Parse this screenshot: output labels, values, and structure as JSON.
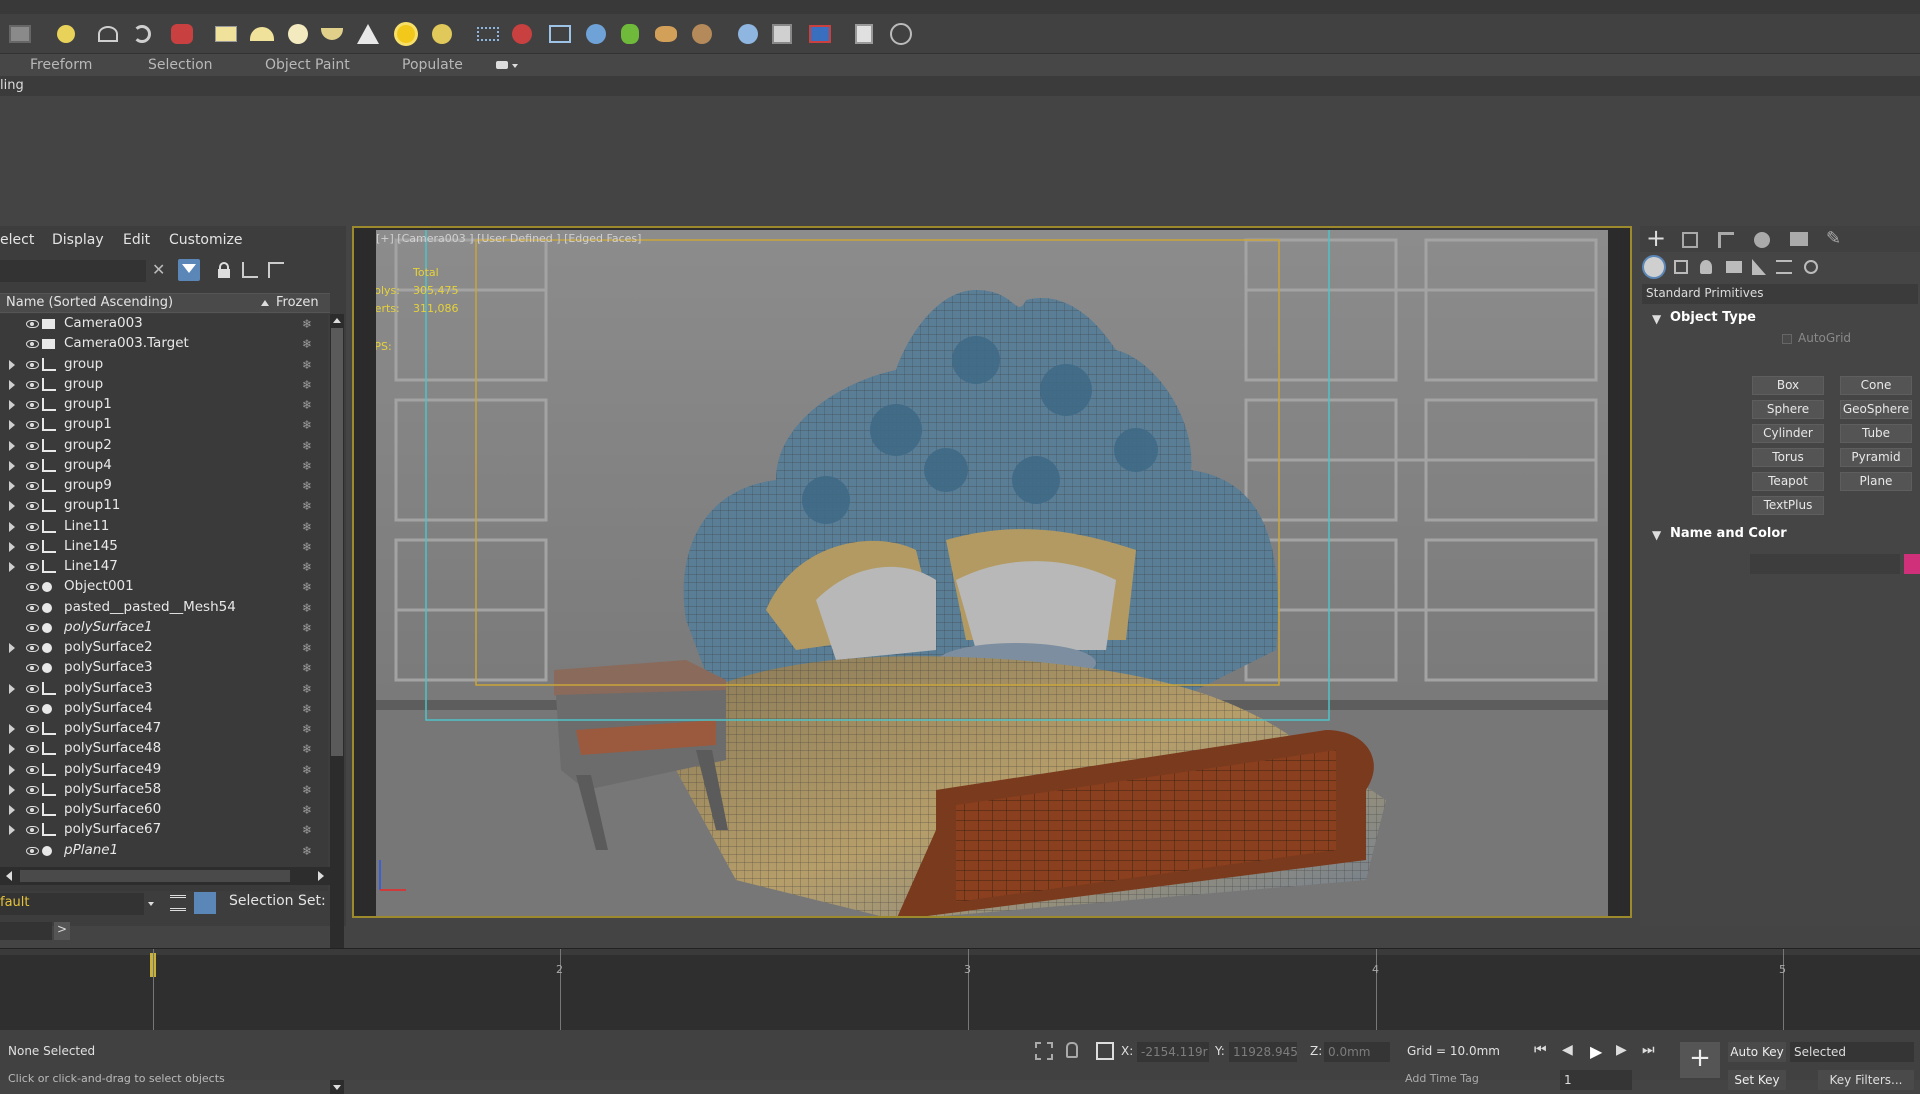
{
  "ribbon": {
    "tabs": [
      "Freeform",
      "Selection",
      "Object Paint",
      "Populate"
    ],
    "strip_label": "ling"
  },
  "scene_explorer": {
    "menu": [
      "elect",
      "Display",
      "Edit",
      "Customize"
    ],
    "column_name": "Name (Sorted Ascending)",
    "column_frozen": "Frozen",
    "items": [
      {
        "name": "Camera003",
        "expand": false,
        "type": "camera",
        "italic": false
      },
      {
        "name": "Camera003.Target",
        "expand": false,
        "type": "camera",
        "italic": false
      },
      {
        "name": "group",
        "expand": true,
        "type": "helper",
        "italic": false
      },
      {
        "name": "group",
        "expand": true,
        "type": "helper",
        "italic": false
      },
      {
        "name": "group1",
        "expand": true,
        "type": "helper",
        "italic": false
      },
      {
        "name": "group1",
        "expand": true,
        "type": "helper",
        "italic": false
      },
      {
        "name": "group2",
        "expand": true,
        "type": "helper",
        "italic": false
      },
      {
        "name": "group4",
        "expand": true,
        "type": "helper",
        "italic": false
      },
      {
        "name": "group9",
        "expand": true,
        "type": "helper",
        "italic": false
      },
      {
        "name": "group11",
        "expand": true,
        "type": "helper",
        "italic": false
      },
      {
        "name": "Line11",
        "expand": true,
        "type": "helper",
        "italic": false
      },
      {
        "name": "Line145",
        "expand": true,
        "type": "helper",
        "italic": false
      },
      {
        "name": "Line147",
        "expand": true,
        "type": "helper",
        "italic": false
      },
      {
        "name": "Object001",
        "expand": false,
        "type": "geometry",
        "italic": false
      },
      {
        "name": "pasted__pasted__Mesh54",
        "expand": false,
        "type": "geometry",
        "italic": false
      },
      {
        "name": "polySurface1",
        "expand": false,
        "type": "geometry",
        "italic": true
      },
      {
        "name": "polySurface2",
        "expand": true,
        "type": "geometry",
        "italic": false
      },
      {
        "name": "polySurface3",
        "expand": false,
        "type": "geometry",
        "italic": false
      },
      {
        "name": "polySurface3",
        "expand": true,
        "type": "helper",
        "italic": false
      },
      {
        "name": "polySurface4",
        "expand": false,
        "type": "geometry",
        "italic": false
      },
      {
        "name": "polySurface47",
        "expand": true,
        "type": "helper",
        "italic": false
      },
      {
        "name": "polySurface48",
        "expand": true,
        "type": "helper",
        "italic": false
      },
      {
        "name": "polySurface49",
        "expand": true,
        "type": "helper",
        "italic": false
      },
      {
        "name": "polySurface58",
        "expand": true,
        "type": "helper",
        "italic": false
      },
      {
        "name": "polySurface60",
        "expand": true,
        "type": "helper",
        "italic": false
      },
      {
        "name": "polySurface67",
        "expand": true,
        "type": "helper",
        "italic": false
      },
      {
        "name": "pPlane1",
        "expand": false,
        "type": "geometry",
        "italic": true
      }
    ],
    "layer_field": "fault",
    "selection_set_label": "Selection Set:"
  },
  "viewport": {
    "label": "[+] [Camera003 ] [User Defined ] [Edged Faces]",
    "stats_total": "Total",
    "polys_label": "Polys:",
    "polys_value": "305,475",
    "verts_label": "Verts:",
    "verts_value": "311,086",
    "fps_label": "FPS:"
  },
  "command_panel": {
    "category": "Standard Primitives",
    "object_type_title": "Object Type",
    "autogrid_label": "AutoGrid",
    "buttons": [
      "Box",
      "Cone",
      "Sphere",
      "GeoSphere",
      "Cylinder",
      "Tube",
      "Torus",
      "Pyramid",
      "Teapot",
      "Plane",
      "TextPlus"
    ],
    "name_color_title": "Name and Color",
    "object_color": "#d0307a"
  },
  "timeline": {
    "ticks": [
      "2",
      "3",
      "4",
      "5"
    ]
  },
  "status": {
    "selection": "None Selected",
    "prompt": "Click or click-and-drag to select objects",
    "x_label": "X:",
    "x_value": "-2154.119r",
    "y_label": "Y:",
    "y_value": "11928.945",
    "z_label": "Z:",
    "z_value": "0.0mm",
    "grid": "Grid = 10.0mm",
    "auto_key": "Auto Key",
    "selected_option": "Selected",
    "set_key": "Set Key",
    "key_filters": "Key Filters...",
    "frame_value": "1",
    "add_time_tag": "Add Time Tag"
  },
  "colors": {
    "viewport_frame": "#9d8a2c",
    "safe_frame_outer": "#4fc3c8",
    "safe_frame_inner": "#c9a53a",
    "stats_text": "#e6d23a"
  }
}
